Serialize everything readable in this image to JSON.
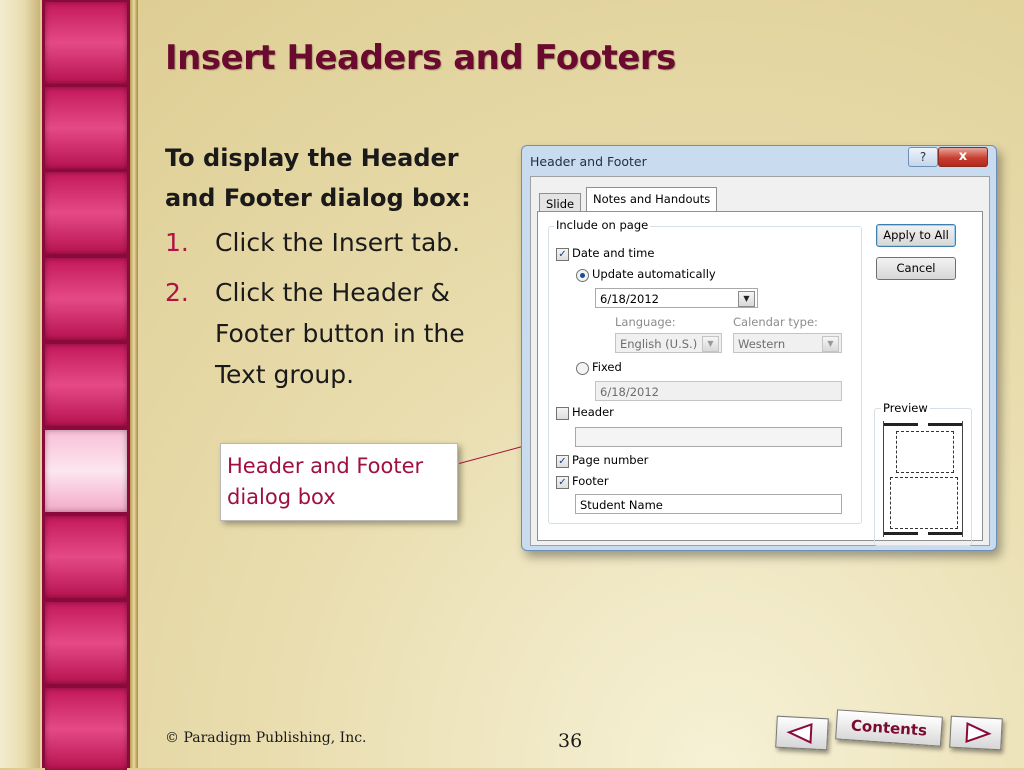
{
  "slide": {
    "title": "Insert Headers and Footers",
    "lead": "To display the Header and Footer dialog box:",
    "steps": [
      {
        "num": "1.",
        "text": "Click the Insert tab."
      },
      {
        "num": "2.",
        "text": "Click the Header & Footer button in the Text group."
      }
    ],
    "callout": "Header and Footer dialog box",
    "copyright": "© Paradigm Publishing, Inc.",
    "page_number": "36",
    "nav": {
      "contents_label": "Contents",
      "prev_icon": "left-arrow-icon",
      "next_icon": "right-arrow-icon"
    },
    "colors": {
      "title": "#6a0a2e",
      "accent": "#b01248",
      "tile": "#c3185a"
    }
  },
  "dialog": {
    "title": "Header and Footer",
    "help_label": "?",
    "close_label": "x",
    "tabs": [
      {
        "label": "Slide",
        "active": false
      },
      {
        "label": "Notes and Handouts",
        "active": true
      }
    ],
    "include_legend": "Include on page",
    "date_time": {
      "label": "Date and time",
      "checked": true
    },
    "update_auto": {
      "label": "Update automatically",
      "selected": true
    },
    "auto_date_value": "6/18/2012",
    "language_label": "Language:",
    "language_value": "English (U.S.)",
    "calendar_label": "Calendar type:",
    "calendar_value": "Western",
    "fixed": {
      "label": "Fixed",
      "selected": false
    },
    "fixed_value": "6/18/2012",
    "header": {
      "label": "Header",
      "checked": false,
      "value": ""
    },
    "page_number": {
      "label": "Page number",
      "checked": true
    },
    "footer": {
      "label": "Footer",
      "checked": true,
      "value": "Student Name"
    },
    "apply_all_label": "Apply to All",
    "cancel_label": "Cancel",
    "preview_label": "Preview"
  }
}
